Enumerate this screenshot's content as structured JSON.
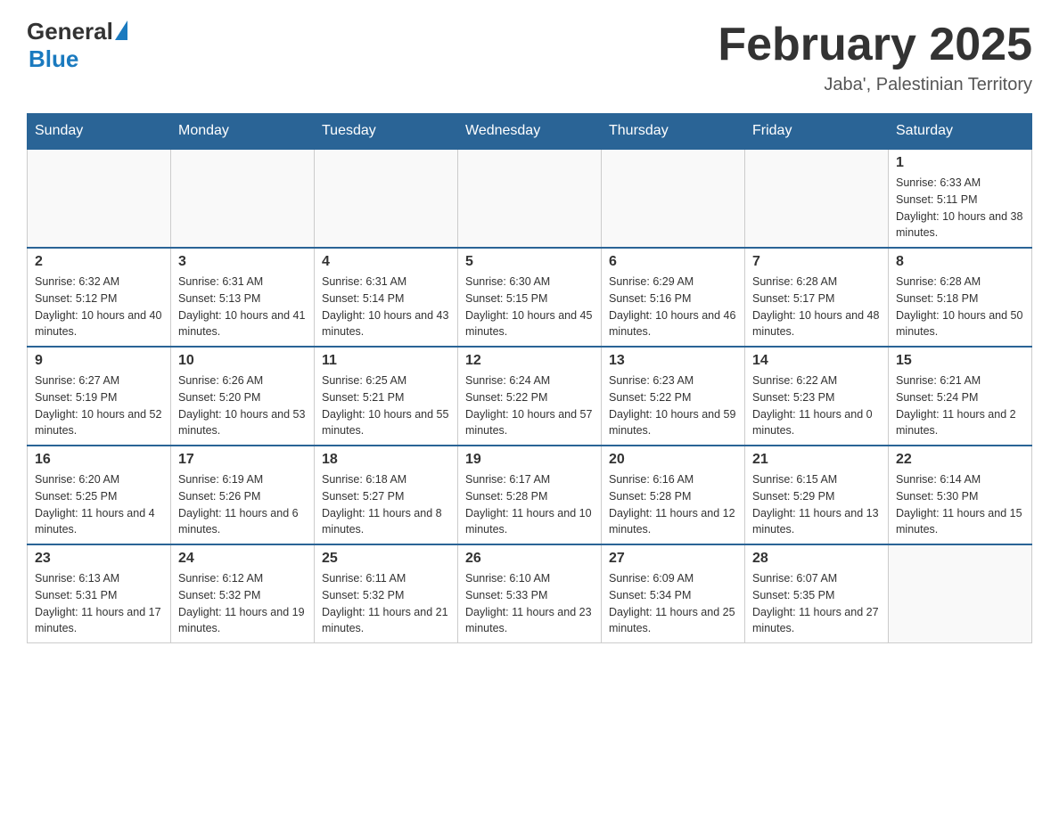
{
  "header": {
    "logo_general": "General",
    "logo_blue": "Blue",
    "title": "February 2025",
    "subtitle": "Jaba', Palestinian Territory"
  },
  "days_of_week": [
    "Sunday",
    "Monday",
    "Tuesday",
    "Wednesday",
    "Thursday",
    "Friday",
    "Saturday"
  ],
  "weeks": [
    [
      {
        "day": "",
        "sunrise": "",
        "sunset": "",
        "daylight": ""
      },
      {
        "day": "",
        "sunrise": "",
        "sunset": "",
        "daylight": ""
      },
      {
        "day": "",
        "sunrise": "",
        "sunset": "",
        "daylight": ""
      },
      {
        "day": "",
        "sunrise": "",
        "sunset": "",
        "daylight": ""
      },
      {
        "day": "",
        "sunrise": "",
        "sunset": "",
        "daylight": ""
      },
      {
        "day": "",
        "sunrise": "",
        "sunset": "",
        "daylight": ""
      },
      {
        "day": "1",
        "sunrise": "Sunrise: 6:33 AM",
        "sunset": "Sunset: 5:11 PM",
        "daylight": "Daylight: 10 hours and 38 minutes."
      }
    ],
    [
      {
        "day": "2",
        "sunrise": "Sunrise: 6:32 AM",
        "sunset": "Sunset: 5:12 PM",
        "daylight": "Daylight: 10 hours and 40 minutes."
      },
      {
        "day": "3",
        "sunrise": "Sunrise: 6:31 AM",
        "sunset": "Sunset: 5:13 PM",
        "daylight": "Daylight: 10 hours and 41 minutes."
      },
      {
        "day": "4",
        "sunrise": "Sunrise: 6:31 AM",
        "sunset": "Sunset: 5:14 PM",
        "daylight": "Daylight: 10 hours and 43 minutes."
      },
      {
        "day": "5",
        "sunrise": "Sunrise: 6:30 AM",
        "sunset": "Sunset: 5:15 PM",
        "daylight": "Daylight: 10 hours and 45 minutes."
      },
      {
        "day": "6",
        "sunrise": "Sunrise: 6:29 AM",
        "sunset": "Sunset: 5:16 PM",
        "daylight": "Daylight: 10 hours and 46 minutes."
      },
      {
        "day": "7",
        "sunrise": "Sunrise: 6:28 AM",
        "sunset": "Sunset: 5:17 PM",
        "daylight": "Daylight: 10 hours and 48 minutes."
      },
      {
        "day": "8",
        "sunrise": "Sunrise: 6:28 AM",
        "sunset": "Sunset: 5:18 PM",
        "daylight": "Daylight: 10 hours and 50 minutes."
      }
    ],
    [
      {
        "day": "9",
        "sunrise": "Sunrise: 6:27 AM",
        "sunset": "Sunset: 5:19 PM",
        "daylight": "Daylight: 10 hours and 52 minutes."
      },
      {
        "day": "10",
        "sunrise": "Sunrise: 6:26 AM",
        "sunset": "Sunset: 5:20 PM",
        "daylight": "Daylight: 10 hours and 53 minutes."
      },
      {
        "day": "11",
        "sunrise": "Sunrise: 6:25 AM",
        "sunset": "Sunset: 5:21 PM",
        "daylight": "Daylight: 10 hours and 55 minutes."
      },
      {
        "day": "12",
        "sunrise": "Sunrise: 6:24 AM",
        "sunset": "Sunset: 5:22 PM",
        "daylight": "Daylight: 10 hours and 57 minutes."
      },
      {
        "day": "13",
        "sunrise": "Sunrise: 6:23 AM",
        "sunset": "Sunset: 5:22 PM",
        "daylight": "Daylight: 10 hours and 59 minutes."
      },
      {
        "day": "14",
        "sunrise": "Sunrise: 6:22 AM",
        "sunset": "Sunset: 5:23 PM",
        "daylight": "Daylight: 11 hours and 0 minutes."
      },
      {
        "day": "15",
        "sunrise": "Sunrise: 6:21 AM",
        "sunset": "Sunset: 5:24 PM",
        "daylight": "Daylight: 11 hours and 2 minutes."
      }
    ],
    [
      {
        "day": "16",
        "sunrise": "Sunrise: 6:20 AM",
        "sunset": "Sunset: 5:25 PM",
        "daylight": "Daylight: 11 hours and 4 minutes."
      },
      {
        "day": "17",
        "sunrise": "Sunrise: 6:19 AM",
        "sunset": "Sunset: 5:26 PM",
        "daylight": "Daylight: 11 hours and 6 minutes."
      },
      {
        "day": "18",
        "sunrise": "Sunrise: 6:18 AM",
        "sunset": "Sunset: 5:27 PM",
        "daylight": "Daylight: 11 hours and 8 minutes."
      },
      {
        "day": "19",
        "sunrise": "Sunrise: 6:17 AM",
        "sunset": "Sunset: 5:28 PM",
        "daylight": "Daylight: 11 hours and 10 minutes."
      },
      {
        "day": "20",
        "sunrise": "Sunrise: 6:16 AM",
        "sunset": "Sunset: 5:28 PM",
        "daylight": "Daylight: 11 hours and 12 minutes."
      },
      {
        "day": "21",
        "sunrise": "Sunrise: 6:15 AM",
        "sunset": "Sunset: 5:29 PM",
        "daylight": "Daylight: 11 hours and 13 minutes."
      },
      {
        "day": "22",
        "sunrise": "Sunrise: 6:14 AM",
        "sunset": "Sunset: 5:30 PM",
        "daylight": "Daylight: 11 hours and 15 minutes."
      }
    ],
    [
      {
        "day": "23",
        "sunrise": "Sunrise: 6:13 AM",
        "sunset": "Sunset: 5:31 PM",
        "daylight": "Daylight: 11 hours and 17 minutes."
      },
      {
        "day": "24",
        "sunrise": "Sunrise: 6:12 AM",
        "sunset": "Sunset: 5:32 PM",
        "daylight": "Daylight: 11 hours and 19 minutes."
      },
      {
        "day": "25",
        "sunrise": "Sunrise: 6:11 AM",
        "sunset": "Sunset: 5:32 PM",
        "daylight": "Daylight: 11 hours and 21 minutes."
      },
      {
        "day": "26",
        "sunrise": "Sunrise: 6:10 AM",
        "sunset": "Sunset: 5:33 PM",
        "daylight": "Daylight: 11 hours and 23 minutes."
      },
      {
        "day": "27",
        "sunrise": "Sunrise: 6:09 AM",
        "sunset": "Sunset: 5:34 PM",
        "daylight": "Daylight: 11 hours and 25 minutes."
      },
      {
        "day": "28",
        "sunrise": "Sunrise: 6:07 AM",
        "sunset": "Sunset: 5:35 PM",
        "daylight": "Daylight: 11 hours and 27 minutes."
      },
      {
        "day": "",
        "sunrise": "",
        "sunset": "",
        "daylight": ""
      }
    ]
  ]
}
